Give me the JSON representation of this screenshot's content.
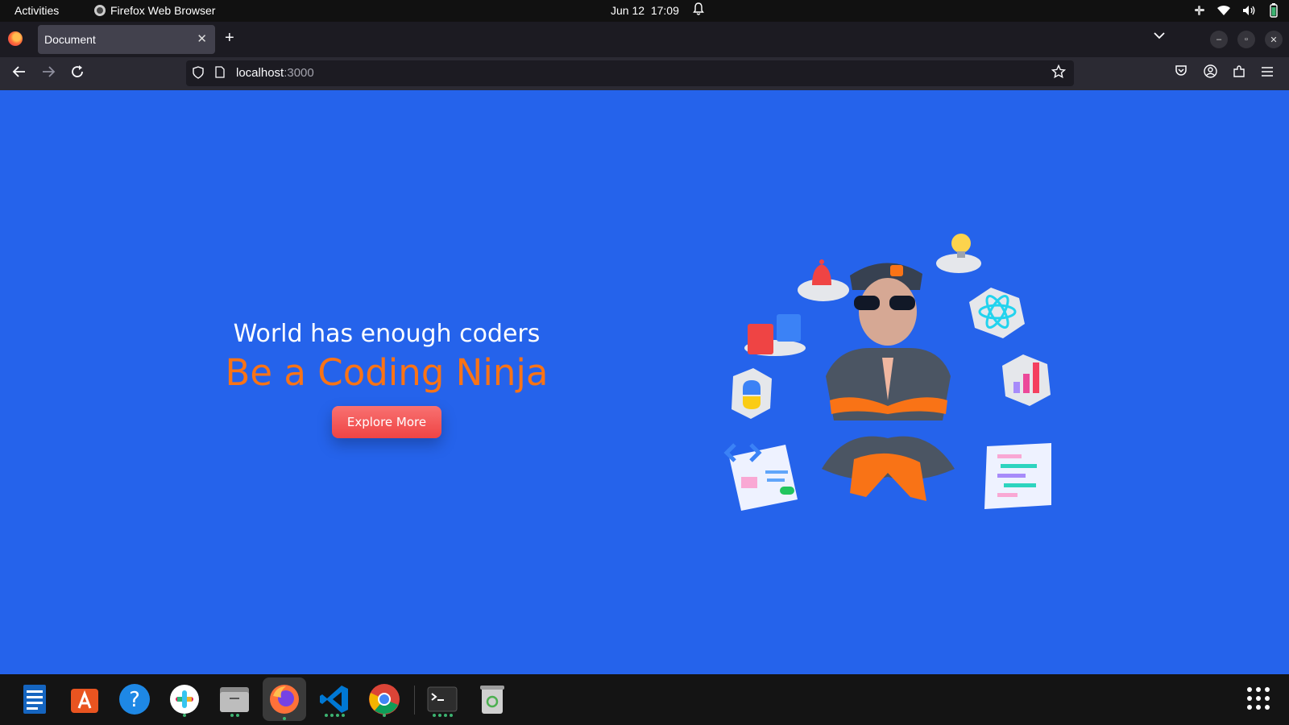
{
  "system_bar": {
    "activities": "Activities",
    "app_name": "Firefox Web Browser",
    "date": "Jun 12",
    "time": "17:09"
  },
  "browser": {
    "tab_title": "Document",
    "url_host": "localhost",
    "url_port": ":3000"
  },
  "page": {
    "subtitle": "World has enough coders",
    "headline": "Be a Coding Ninja",
    "cta_label": "Explore More",
    "colors": {
      "background": "#2563eb",
      "headline": "#f97316",
      "cta": "#ef4444"
    }
  },
  "dock": {
    "items": [
      "text-editor-icon",
      "app-center-icon",
      "help-icon",
      "slack-icon",
      "files-icon",
      "firefox-icon",
      "vscode-icon",
      "chrome-icon",
      "terminal-icon",
      "trash-icon"
    ]
  }
}
